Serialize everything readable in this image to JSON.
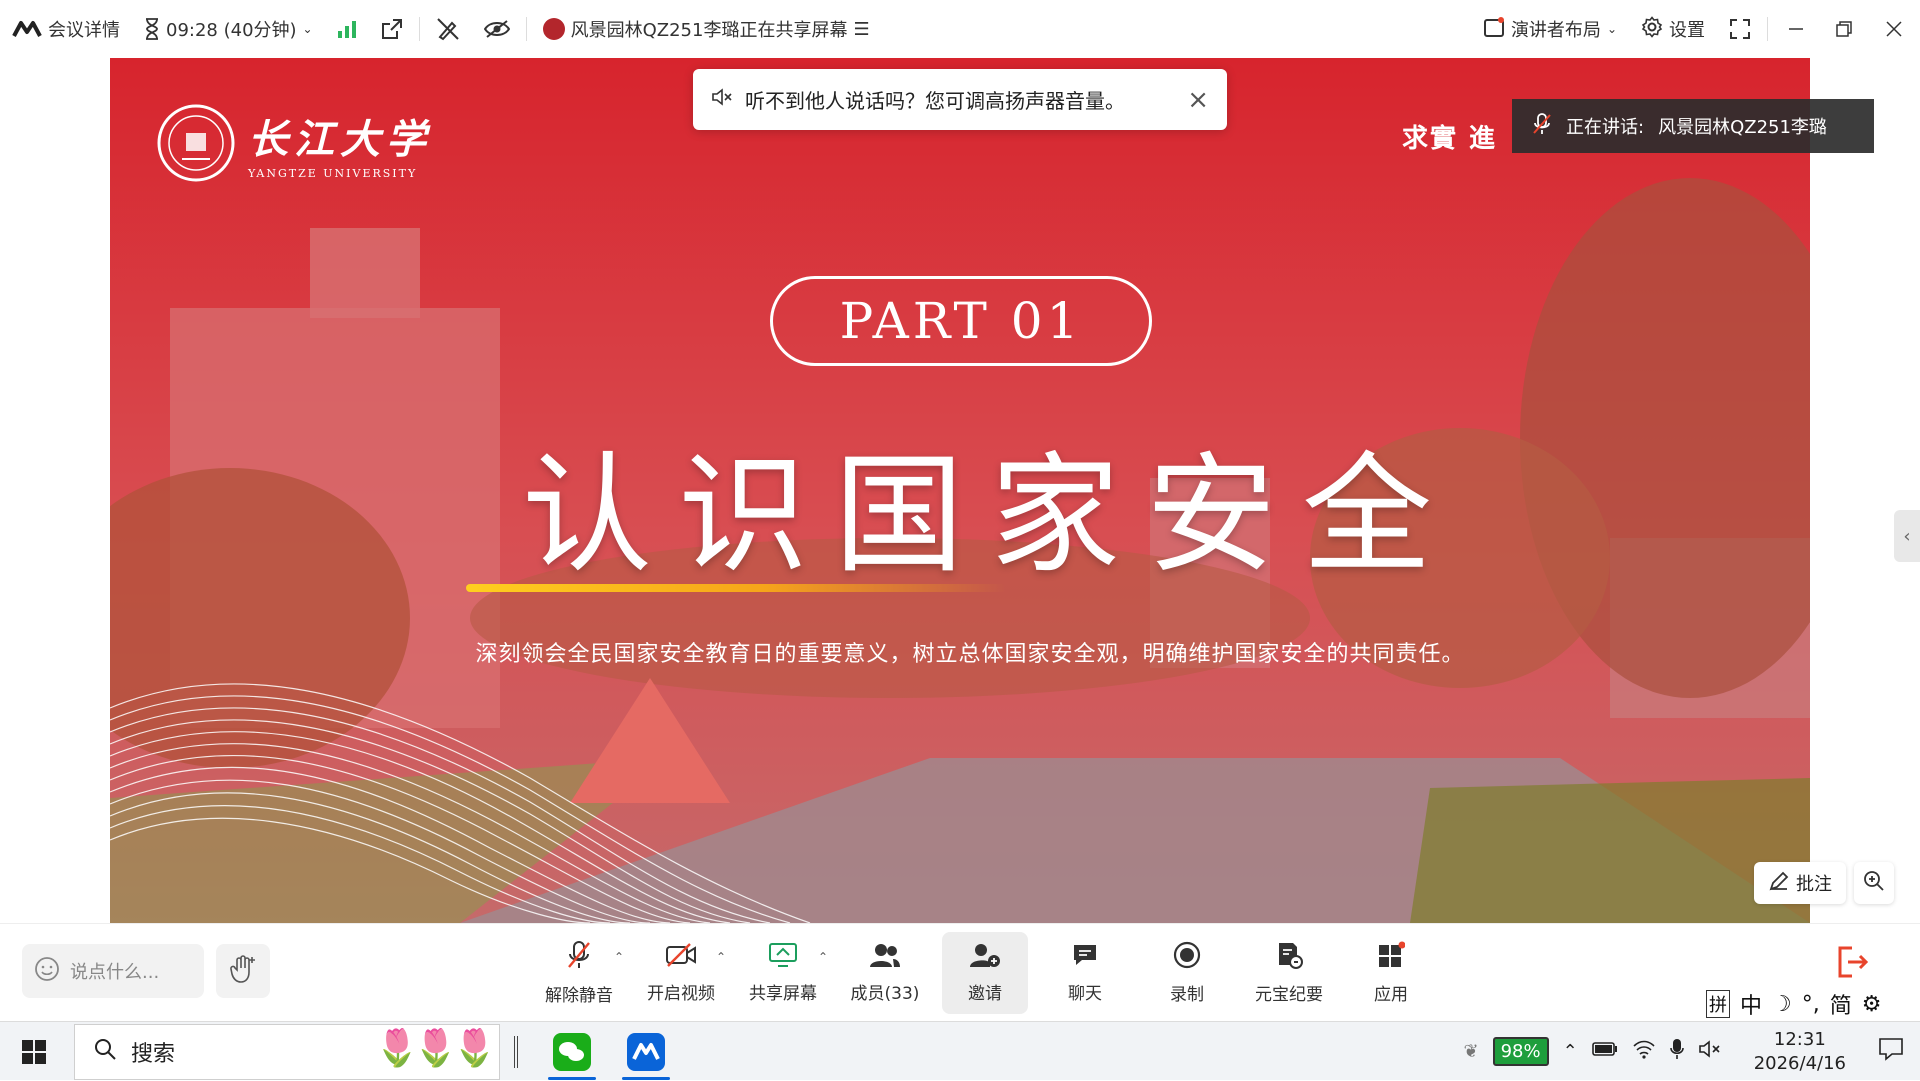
{
  "topbar": {
    "meeting_details": "会议详情",
    "timer": "09:28 (40分钟)",
    "sharing_text": "风景园林QZ251李璐正在共享屏幕",
    "speaker_layout": "演讲者布局",
    "settings": "设置"
  },
  "slide": {
    "logo_cn": "长江大学",
    "logo_en": "YANGTZE UNIVERSITY",
    "motto": "求實  進",
    "part": "PART  01",
    "title": "认识国家安全",
    "subtitle": "深刻领会全民国家安全教育日的重要意义，树立总体国家安全观，明确维护国家安全的共同责任。"
  },
  "toast": {
    "text": "听不到他人说话吗？您可调高扬声器音量。",
    "close": "×"
  },
  "speaking": {
    "label": "正在讲话:",
    "name": "风景园林QZ251李璐"
  },
  "annotate": {
    "label": "批注"
  },
  "toolbar": {
    "chat_placeholder": "说点什么...",
    "unmute": "解除静音",
    "start_video": "开启视频",
    "share_screen": "共享屏幕",
    "members": "成员(33)",
    "invite": "邀请",
    "chat": "聊天",
    "record": "录制",
    "yuanbao": "元宝纪要",
    "apps": "应用"
  },
  "ime": {
    "pin": "拼",
    "zh": "中",
    "jian": "简"
  },
  "taskbar": {
    "search": "搜索",
    "battery": "98%",
    "time": "12:31",
    "date": "2026/4/16"
  },
  "colors": {
    "slide_red": "#c9252f",
    "accent_yellow": "#ffcf1f",
    "signal_green": "#2db55d",
    "taskbar_blue": "#0a64d8"
  }
}
